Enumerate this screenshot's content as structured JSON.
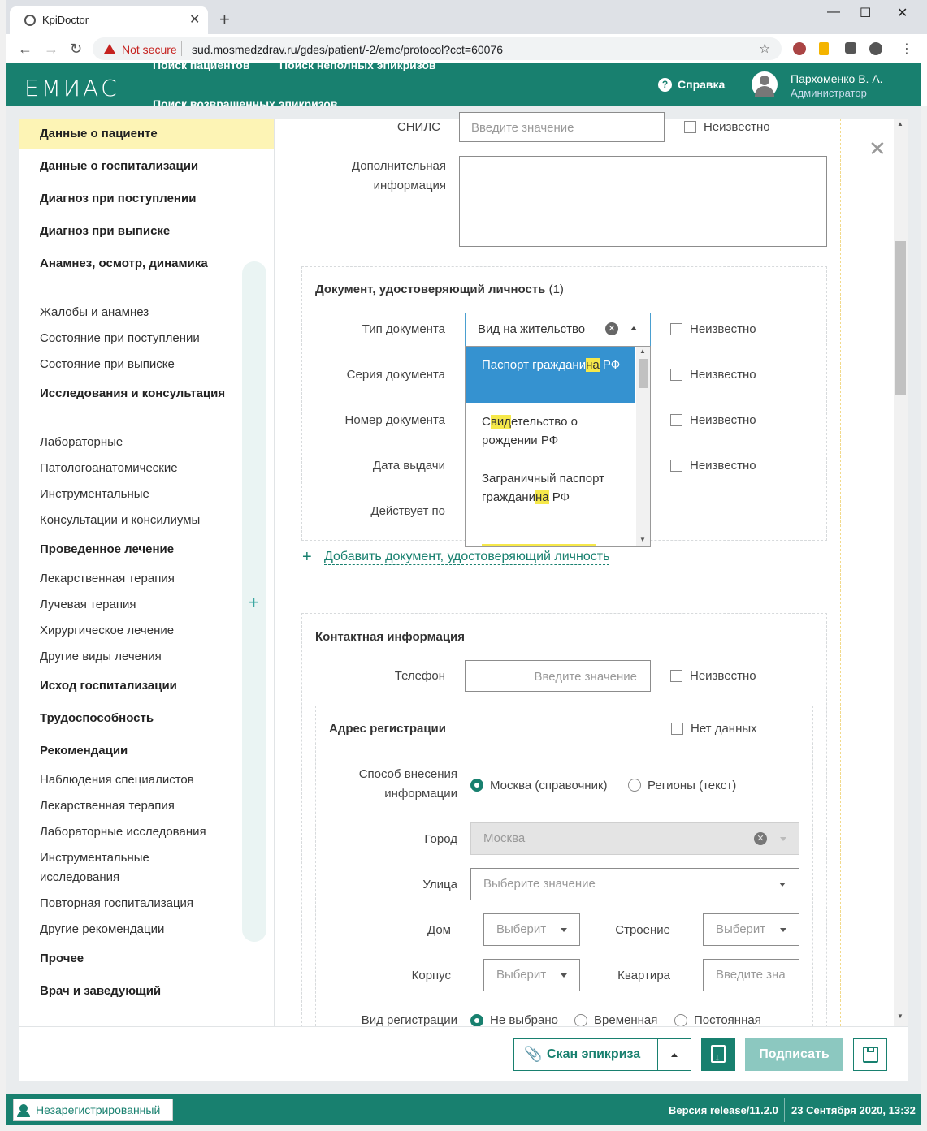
{
  "browser": {
    "tab_title": "KpiDoctor",
    "tab_close": "✕",
    "new_tab": "+",
    "not_secure": "Not secure",
    "url": "sud.mosmedzdrav.ru/gdes/patient/-2/emc/protocol?cct=60076",
    "win_min": "—",
    "win_max": "☐",
    "win_close": "✕"
  },
  "header": {
    "logo": "ЕМИАС",
    "nav": [
      "Поиск пациентов",
      "Поиск неполных эпикризов",
      "Поиск возвращенных эпикризов"
    ],
    "help_label": "Справка",
    "user_name": "Пархоменко В. А.",
    "user_role": "Администратор"
  },
  "sidebar": {
    "items": [
      {
        "label": "Данные о пациенте",
        "bold": true,
        "active": true
      },
      {
        "label": "Данные о госпитализации",
        "bold": true
      },
      {
        "label": "Диагноз при поступлении",
        "bold": true
      },
      {
        "label": "Диагноз при выписке",
        "bold": true
      },
      {
        "label": "Анамнез, осмотр, динамика",
        "bold": true
      },
      {
        "label": "Жалобы и анамнез"
      },
      {
        "label": "Состояние при поступлении"
      },
      {
        "label": "Состояние при выписке"
      },
      {
        "label": "Исследования и консультация",
        "bold": true
      },
      {
        "label": "Лабораторные"
      },
      {
        "label": "Патологоанатомические"
      },
      {
        "label": "Инструментальные"
      },
      {
        "label": "Консультации и консилиумы"
      },
      {
        "label": "Проведенное лечение",
        "bold": true
      },
      {
        "label": "Лекарственная терапия"
      },
      {
        "label": "Лучевая терапия"
      },
      {
        "label": "Хирургическое лечение"
      },
      {
        "label": "Другие виды лечения"
      },
      {
        "label": "Исход госпитализации",
        "bold": true
      },
      {
        "label": "Трудоспособность",
        "bold": true
      },
      {
        "label": "Рекомендации",
        "bold": true
      },
      {
        "label": "Наблюдения специалистов"
      },
      {
        "label": "Лекарственная терапия"
      },
      {
        "label": "Лабораторные исследования"
      },
      {
        "label": "Инструментальные исследования"
      },
      {
        "label": "Повторная госпитализация"
      },
      {
        "label": "Другие рекомендации"
      },
      {
        "label": "Прочее",
        "bold": true
      },
      {
        "label": "Врач и заведующий",
        "bold": true
      }
    ],
    "plus": "+"
  },
  "form": {
    "snils_label": "СНИЛС",
    "snils_placeholder": "Введите значение",
    "unknown": "Неизвестно",
    "additional_label": "Дополнительная информация",
    "id_doc": {
      "title": "Документ, удостоверяющий личность",
      "count": "(1)",
      "type_label": "Тип документа",
      "type_value": "Вид на жительство",
      "series_label": "Серия документа",
      "number_label": "Номер документа",
      "issue_date_label": "Дата выдачи",
      "valid_until_label": "Действует по",
      "dropdown_options": [
        {
          "parts": [
            "Паспорт граждани",
            "на",
            " РФ"
          ]
        },
        {
          "parts": [
            "С",
            "вид",
            "етельство о рождении РФ"
          ]
        },
        {
          "parts": [
            "Заграничный паспорт граждани",
            "на",
            " РФ"
          ]
        }
      ]
    },
    "add_doc_link": "Добавить документ, удостоверяющий личность",
    "contact": {
      "title": "Контактная информация",
      "phone_label": "Телефон",
      "phone_placeholder": "Введите значение"
    },
    "address": {
      "title": "Адрес регистрации",
      "no_data": "Нет данных",
      "method_label": "Способ внесения информации",
      "method_options": [
        "Москва (справочник)",
        "Регионы (текст)"
      ],
      "method_selected": "Москва (справочник)",
      "city_label": "Город",
      "city_value": "Москва",
      "street_label": "Улица",
      "street_placeholder": "Выберите значение",
      "house_label": "Дом",
      "house_placeholder": "Выберит",
      "building_label": "Строение",
      "building_placeholder": "Выберит",
      "korpus_label": "Корпус",
      "korpus_placeholder": "Выберит",
      "apartment_label": "Квартира",
      "apartment_placeholder": "Введите зна",
      "reg_type_label": "Вид регистрации",
      "reg_type_options": [
        "Не выбрано",
        "Временная",
        "Постоянная"
      ],
      "reg_type_selected": "Не выбрано"
    }
  },
  "toolbar": {
    "scan_label": "Скан эпикриза",
    "sign_label": "Подписать"
  },
  "status": {
    "user": "Незарегистрированный",
    "version": "Версия release/11.2.0",
    "date": "23 Сентября 2020, 13:32"
  },
  "colors": {
    "brand": "#18806f",
    "active_item": "#fdf4b5",
    "highlight": "#f6e84a",
    "dropdown_selected": "#3592d0"
  }
}
